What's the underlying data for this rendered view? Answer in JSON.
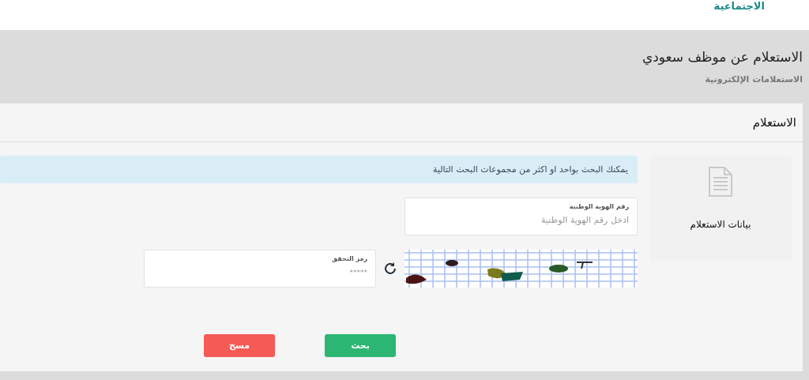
{
  "top_link": "الاجتماعية",
  "page": {
    "title": "الاستعلام عن موظف سعودي",
    "breadcrumb": "الاستعلامات الإلكترونية"
  },
  "card": {
    "title": "الاستعلام"
  },
  "sidebar": {
    "label": "بيانات الاستعلام"
  },
  "alert": "يمكنك البحث بواحد او اكثر من مجموعات البحث التالية",
  "id_field": {
    "label": "رقم الهوية الوطنية",
    "placeholder": "ادخل رقم الهوية الوطنية"
  },
  "captcha": {
    "kind": "picture",
    "field_label": "رمز التحقق",
    "placeholder": "*****"
  },
  "buttons": [
    {
      "label": "بحث",
      "kind": "primary"
    },
    {
      "label": "مسح",
      "kind": "danger"
    }
  ]
}
